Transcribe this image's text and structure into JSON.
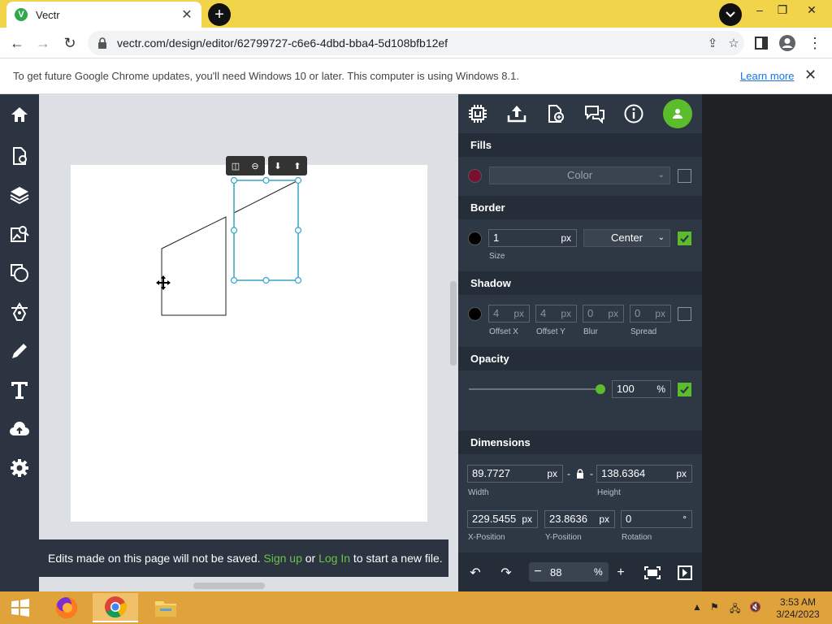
{
  "browser": {
    "tab_title": "Vectr",
    "tab_favicon_letter": "V",
    "url": "vectr.com/design/editor/62799727-c6e6-4dbd-bba4-5d108bfb12ef",
    "infobar_message": "To get future Google Chrome updates, you'll need Windows 10 or later. This computer is using Windows 8.1.",
    "infobar_link": "Learn more"
  },
  "sidebar": {
    "items": [
      "home-icon",
      "new-page-icon",
      "layers-icon",
      "image-search-icon",
      "shapes-icon",
      "pen-tool-icon",
      "pencil-icon",
      "text-icon",
      "upload-cloud-icon",
      "settings-icon"
    ]
  },
  "canvas": {
    "notice_prefix": "Edits made on this page will not be saved. ",
    "notice_signup": "Sign up",
    "notice_or": " or ",
    "notice_login": "Log In",
    "notice_suffix": " to start a new file."
  },
  "panel": {
    "fills": {
      "title": "Fills",
      "color_label": "Color",
      "swatch": "#7a1030"
    },
    "border": {
      "title": "Border",
      "size_value": "1",
      "size_unit": "px",
      "size_label": "Size",
      "position": "Center",
      "swatch": "#000000"
    },
    "shadow": {
      "title": "Shadow",
      "offset_x": "4",
      "offset_y": "4",
      "blur": "0",
      "spread": "0",
      "unit": "px",
      "offset_x_label": "Offset X",
      "offset_y_label": "Offset Y",
      "blur_label": "Blur",
      "spread_label": "Spread",
      "swatch": "#000000"
    },
    "opacity": {
      "title": "Opacity",
      "value": "100",
      "unit": "%",
      "level": 1.0
    },
    "dimensions": {
      "title": "Dimensions",
      "width": "89.7727",
      "height": "138.6364",
      "x": "229.5455",
      "y": "23.8636",
      "rotation": "0",
      "unit": "px",
      "rotation_unit": "°",
      "link_sep": "-",
      "width_label": "Width",
      "height_label": "Height",
      "x_label": "X-Position",
      "y_label": "Y-Position",
      "rotation_label": "Rotation"
    },
    "zoom": {
      "value": "88",
      "unit": "%",
      "minus": "−",
      "plus": "+"
    }
  },
  "taskbar": {
    "time": "3:53 AM",
    "date": "3/24/2023"
  },
  "colors": {
    "accent_green": "#5bbd2c",
    "panel_bg": "#2e3844",
    "tabstrip": "#f1d44a",
    "taskbar": "#e0a33c"
  }
}
